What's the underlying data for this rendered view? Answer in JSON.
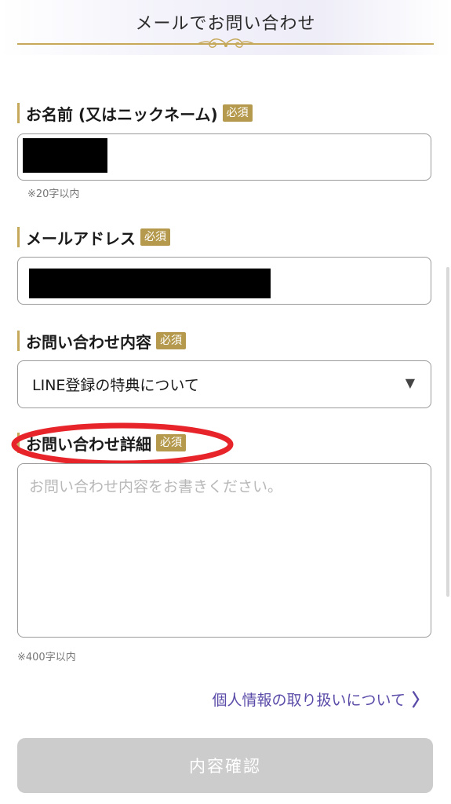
{
  "header": {
    "title": "メールでお問い合わせ",
    "ornament_icon": "gold-flourish-ornament",
    "accent_color": "#c6a85a"
  },
  "form": {
    "required_badge": "必須",
    "name_field": {
      "label": "お名前 (又はニックネーム)",
      "hint": "※20字以内",
      "value_redacted": true
    },
    "email_field": {
      "label": "メールアドレス",
      "value_redacted": true
    },
    "inquiry_type": {
      "label": "お問い合わせ内容",
      "selected": "LINE登録の特典について",
      "arrow": "▼"
    },
    "inquiry_detail": {
      "label": "お問い合わせ詳細",
      "placeholder": "お問い合わせ内容をお書きください。",
      "hint": "※400字以内",
      "annotation_color": "#e8242b"
    }
  },
  "privacy_link": {
    "label": "個人情報の取り扱いについて",
    "chevron": "〉",
    "color": "#5b4ba8"
  },
  "confirm_button": {
    "label": "内容確認"
  }
}
